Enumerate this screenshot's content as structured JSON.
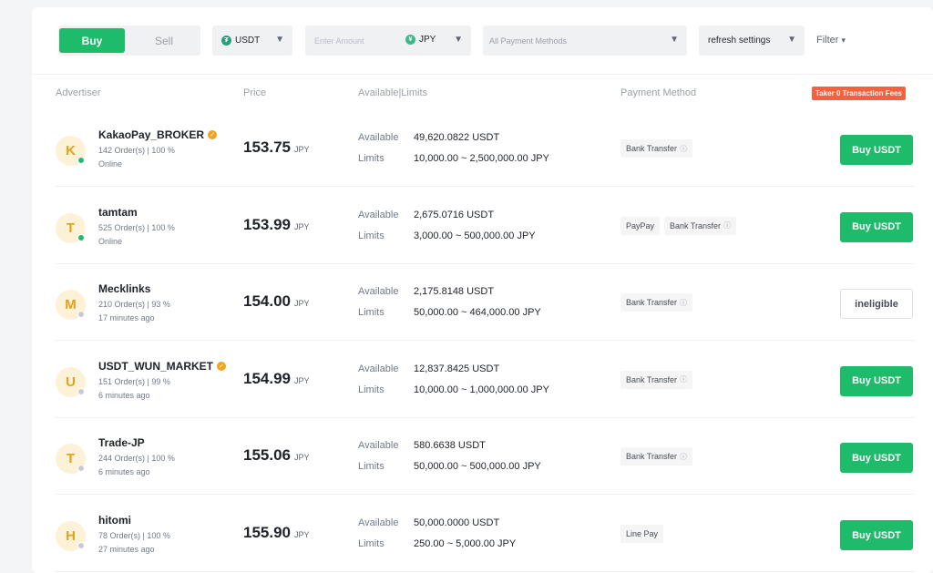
{
  "toolbar": {
    "buy_label": "Buy",
    "sell_label": "Sell",
    "coin": "USDT",
    "coin_icon": "tether-icon",
    "amount_placeholder": "Enter Amount",
    "currency": "JPY",
    "payment_placeholder": "All Payment Methods",
    "refresh": "refresh settings",
    "filter": "Filter"
  },
  "header": {
    "advertiser": "Advertiser",
    "price": "Price",
    "available_limits": "Available|Limits",
    "payment_method": "Payment Method",
    "fee_tag": "Taker 0 Transaction Fees"
  },
  "labels": {
    "available": "Available",
    "limits": "Limits",
    "price_currency": "JPY"
  },
  "colors": {
    "accent": "#1ebc6a",
    "online": "#1ebc6a",
    "offline": "#c8ccd2",
    "fee_tag": "#f6603a"
  },
  "rows": [
    {
      "initial": "K",
      "name": "KakaoPay_BROKER",
      "verified": true,
      "orders": "142 Order(s)  |  100 %",
      "status": "Online",
      "online": true,
      "price": "153.75",
      "available": "49,620.0822 USDT",
      "limits": "10,000.00 ~ 2,500,000.00 JPY",
      "payments": [
        "Bank Transfer"
      ],
      "action": "Buy USDT",
      "eligible": true
    },
    {
      "initial": "T",
      "name": "tamtam",
      "verified": false,
      "orders": "525 Order(s)  |  100 %",
      "status": "Online",
      "online": true,
      "price": "153.99",
      "available": "2,675.0716 USDT",
      "limits": "3,000.00 ~ 500,000.00 JPY",
      "payments": [
        "PayPay",
        "Bank Transfer"
      ],
      "action": "Buy USDT",
      "eligible": true
    },
    {
      "initial": "M",
      "name": "Mecklinks",
      "verified": false,
      "orders": "210 Order(s)  |  93 %",
      "status": "17 minutes ago",
      "online": false,
      "price": "154.00",
      "available": "2,175.8148 USDT",
      "limits": "50,000.00 ~ 464,000.00 JPY",
      "payments": [
        "Bank Transfer"
      ],
      "action": "ineligible",
      "eligible": false
    },
    {
      "initial": "U",
      "name": "USDT_WUN_MARKET",
      "verified": true,
      "orders": "151 Order(s)  |  99 %",
      "status": "6 minutes ago",
      "online": false,
      "price": "154.99",
      "available": "12,837.8425 USDT",
      "limits": "10,000.00 ~ 1,000,000.00 JPY",
      "payments": [
        "Bank Transfer"
      ],
      "action": "Buy USDT",
      "eligible": true
    },
    {
      "initial": "T",
      "name": "Trade-JP",
      "verified": false,
      "orders": "244 Order(s)  |  100 %",
      "status": "6 minutes ago",
      "online": false,
      "price": "155.06",
      "available": "580.6638 USDT",
      "limits": "50,000.00 ~ 500,000.00 JPY",
      "payments": [
        "Bank Transfer"
      ],
      "action": "Buy USDT",
      "eligible": true
    },
    {
      "initial": "H",
      "name": "hitomi",
      "verified": false,
      "orders": "78 Order(s)  |  100 %",
      "status": "27 minutes ago",
      "online": false,
      "price": "155.90",
      "available": "50,000.0000 USDT",
      "limits": "250.00 ~ 5,000.00 JPY",
      "payments": [
        "Line Pay"
      ],
      "action": "Buy USDT",
      "eligible": true
    }
  ]
}
